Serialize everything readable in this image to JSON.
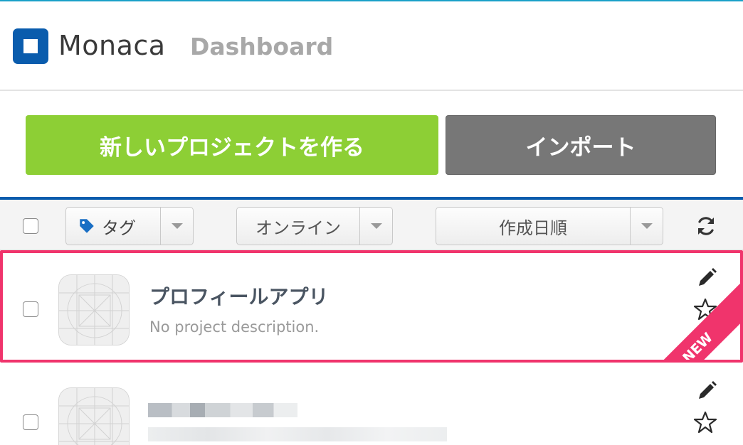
{
  "header": {
    "brand": "Monaca",
    "subtitle": "Dashboard"
  },
  "actions": {
    "new_project_label": "新しいプロジェクトを作る",
    "import_label": "インポート"
  },
  "toolbar": {
    "tag_label": "タグ",
    "online_label": "オンライン",
    "sort_label": "作成日順"
  },
  "projects": [
    {
      "title": "プロフィールアプリ",
      "description": "No project description.",
      "badge": "NEW"
    },
    {
      "title": "",
      "description": ""
    }
  ],
  "colors": {
    "brand_blue": "#0a5cad",
    "new_green": "#8dcf35",
    "import_gray": "#777777",
    "highlight_pink": "#f0346c"
  },
  "icons": [
    "tag-icon",
    "refresh-icon",
    "pencil-icon",
    "star-icon",
    "chevron-down-icon"
  ]
}
